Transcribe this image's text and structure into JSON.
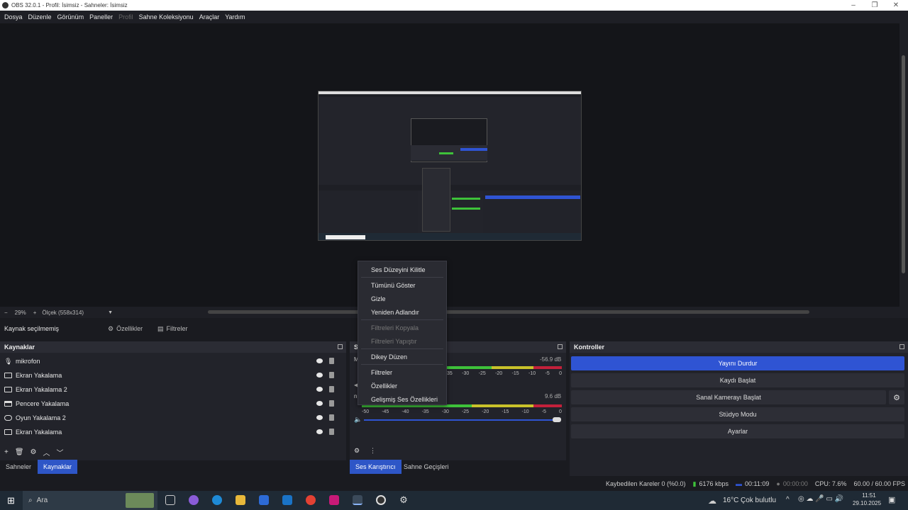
{
  "window": {
    "title": "OBS 32.0.1 - Profil: İsimsiz - Sahneler: İsimsiz"
  },
  "menu": [
    "Dosya",
    "Düzenle",
    "Görünüm",
    "Paneller",
    "Profil",
    "Sahne Koleksiyonu",
    "Araçlar",
    "Yardım"
  ],
  "preview_bar": {
    "zoom": "29%",
    "scale": "Ölçek (558x314)"
  },
  "source_toolbar": {
    "no_source": "Kaynak seçilmemiş",
    "properties": "Özellikler",
    "filters": "Filtreler"
  },
  "sources": {
    "title": "Kaynaklar",
    "items": [
      {
        "label": "mikrofon",
        "icon": "microphone-icon"
      },
      {
        "label": "Ekran Yakalama",
        "icon": "monitor-icon"
      },
      {
        "label": "Ekran Yakalama 2",
        "icon": "monitor-icon"
      },
      {
        "label": "Pencere Yakalama",
        "icon": "window-icon"
      },
      {
        "label": "Oyun Yakalama 2",
        "icon": "gamepad-icon"
      },
      {
        "label": "Ekran Yakalama",
        "icon": "monitor-icon"
      }
    ]
  },
  "bottom_tabs_left": {
    "scenes": "Sahneler",
    "sources": "Kaynaklar"
  },
  "mixer": {
    "title_visible": "Se",
    "row1_db": "-56.9 dB",
    "row2_db": "9.6 dB",
    "row1_label": "M",
    "row2_label": "n",
    "ticks": [
      "-50",
      "-45",
      "-40",
      "-35",
      "-30",
      "-25",
      "-20",
      "-15",
      "-10",
      "-5",
      "0"
    ],
    "ticks_visible_row1": [
      "35",
      "-30",
      "-25",
      "-20",
      "-15",
      "-10",
      "-5",
      "0"
    ]
  },
  "bottom_tabs_mid": {
    "mixer": "Ses Karıştırıcı",
    "transitions": "Sahne Geçişleri"
  },
  "controls": {
    "title": "Kontroller",
    "buttons": [
      "Yayını Durdur",
      "Kaydı Başlat",
      "Sanal Kamerayı Başlat",
      "Stüdyo Modu",
      "Ayarlar"
    ]
  },
  "context_menu": {
    "items": [
      {
        "label": "Ses Düzeyini Kilitle",
        "enabled": true
      },
      {
        "label": "Tümünü Göster",
        "enabled": true
      },
      {
        "label": "Gizle",
        "enabled": true
      },
      {
        "label": "Yeniden Adlandır",
        "enabled": true
      },
      {
        "label": "Filtreleri Kopyala",
        "enabled": false
      },
      {
        "label": "Filtreleri Yapıştır",
        "enabled": false
      },
      {
        "label": "Dikey Düzen",
        "enabled": true
      },
      {
        "label": "Filtreler",
        "enabled": true
      },
      {
        "label": "Özellikler",
        "enabled": true
      },
      {
        "label": "Gelişmiş Ses Özellikleri",
        "enabled": true
      }
    ]
  },
  "status": {
    "dropped": "Kaybedilen Kareler 0 (%0.0)",
    "bitrate": "6176 kbps",
    "stream_time": "00:11:09",
    "rec_time": "00:00:00",
    "cpu": "CPU: 7.6%",
    "fps": "60.00 / 60.00 FPS"
  },
  "taskbar": {
    "search_placeholder": "Ara",
    "weather": "16°C",
    "weather_desc": "Çok bulutlu",
    "time": "11:51",
    "date": "29.10.2025"
  },
  "colors": {
    "accent": "#2f54d3",
    "meter_green": "#3ec23a",
    "meter_yellow": "#c9c22a",
    "meter_red": "#c3203a"
  }
}
